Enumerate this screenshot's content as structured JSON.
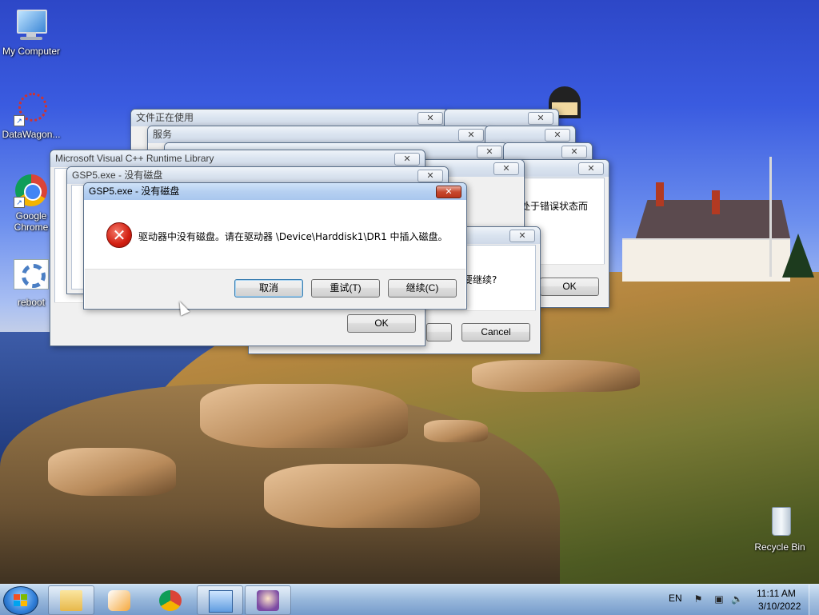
{
  "desktop": {
    "icons": [
      {
        "label": "My Computer"
      },
      {
        "label": "DataWagon..."
      },
      {
        "label": "Google\nChrome"
      },
      {
        "label": "reboot"
      },
      {
        "label": "Recycle Bin"
      }
    ]
  },
  "windows": {
    "file_in_use": {
      "title": "文件正在使用"
    },
    "services": {
      "title": "服务"
    },
    "back_right_a": {
      "title": ""
    },
    "back_right_b": {
      "title": ""
    },
    "back_right_c": {
      "title": ""
    },
    "error_state": {
      "title": "",
      "message_fragment": "处于错误状态而",
      "ok_label": "OK"
    },
    "continue_prompt": {
      "title": "",
      "message_fragment": "否要继续?",
      "cancel_label": "Cancel"
    },
    "msvc_runtime": {
      "title": "Microsoft Visual C++ Runtime Library",
      "ok_label": "OK"
    },
    "gsp5_behind": {
      "title": "GSP5.exe - 没有磁盘"
    },
    "gsp5_front": {
      "title": "GSP5.exe - 没有磁盘",
      "message": "驱动器中没有磁盘。请在驱动器 \\Device\\Harddisk1\\DR1 中插入磁盘。",
      "buttons": {
        "cancel": "取消",
        "retry": "重试(T)",
        "continue": "继续(C)"
      }
    }
  },
  "taskbar": {
    "language": "EN",
    "clock_time": "11:11 AM",
    "clock_date": "3/10/2022",
    "pinned": [
      "explorer-icon",
      "media-player-icon",
      "chrome-icon",
      "control-panel-icon",
      "character-app-icon"
    ]
  },
  "icons": {
    "close": "✕",
    "error": "✕"
  },
  "colors": {
    "active_close": "#c7482e",
    "taskbar": "#8cafd7",
    "error_red": "#d21f11"
  }
}
